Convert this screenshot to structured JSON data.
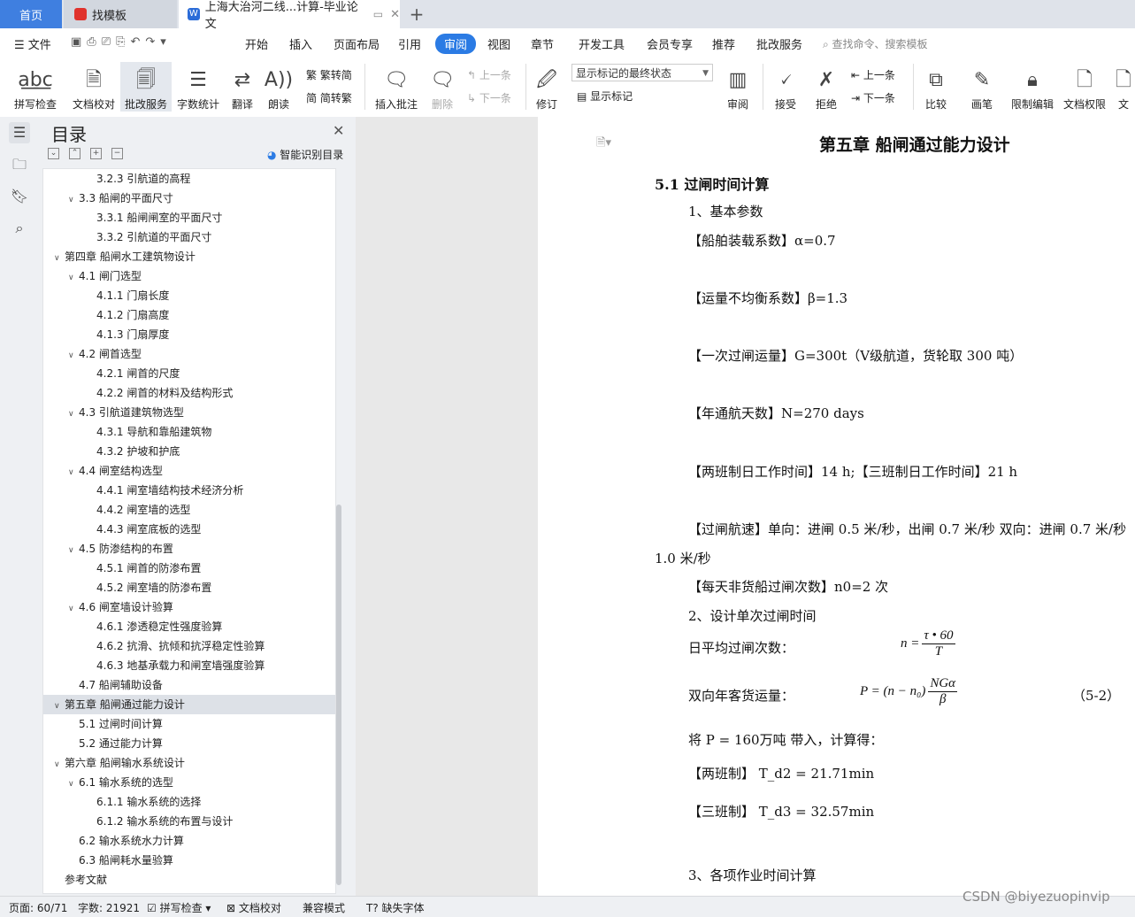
{
  "tabs": {
    "home": "首页",
    "find": "找模板",
    "doc": "上海大治河二线...计算-毕业论文",
    "plus": "+"
  },
  "menu": {
    "file": "文件",
    "items": [
      "开始",
      "插入",
      "页面布局",
      "引用",
      "审阅",
      "视图",
      "章节",
      "开发工具",
      "会员专享",
      "推荐",
      "批改服务"
    ],
    "search": "查找命令、搜索模板"
  },
  "ribbon": {
    "spell": "拼写检查",
    "doccheck": "文档校对",
    "correct": "批改服务",
    "wordcount": "字数统计",
    "translate": "翻译",
    "read": "朗读",
    "trad": "繁转简",
    "simp": "简转繁",
    "insert_comment": "插入批注",
    "delete": "删除",
    "prev": "上一条",
    "next": "下一条",
    "revise": "修订",
    "markup_select": "显示标记的最终状态",
    "show_markup": "显示标记",
    "review": "审阅",
    "accept": "接受",
    "reject": "拒绝",
    "prev2": "上一条",
    "next2": "下一条",
    "compare": "比较",
    "pen": "画笔",
    "restrict": "限制编辑",
    "rights": "文档权限",
    "doc_more": "文"
  },
  "toc": {
    "title": "目录",
    "smart": "智能识别目录",
    "items": [
      {
        "level": 3,
        "text": "3.2.3 引航道的高程"
      },
      {
        "level": 2,
        "text": "3.3 船闸的平面尺寸",
        "caret": "∨"
      },
      {
        "level": 3,
        "text": "3.3.1 船闸闸室的平面尺寸"
      },
      {
        "level": 3,
        "text": "3.3.2 引航道的平面尺寸"
      },
      {
        "level": 1,
        "text": "第四章  船闸水工建筑物设计",
        "caret": "∨"
      },
      {
        "level": 2,
        "text": "4.1 闸门选型",
        "caret": "∨"
      },
      {
        "level": 3,
        "text": "4.1.1 门扇长度"
      },
      {
        "level": 3,
        "text": "4.1.2 门扇高度"
      },
      {
        "level": 3,
        "text": "4.1.3 门扇厚度"
      },
      {
        "level": 2,
        "text": "4.2 闸首选型",
        "caret": "∨"
      },
      {
        "level": 3,
        "text": "4.2.1 闸首的尺度"
      },
      {
        "level": 3,
        "text": "4.2.2 闸首的材料及结构形式"
      },
      {
        "level": 2,
        "text": "4.3 引航道建筑物选型",
        "caret": "∨"
      },
      {
        "level": 3,
        "text": "4.3.1 导航和靠船建筑物"
      },
      {
        "level": 3,
        "text": "4.3.2 护坡和护底"
      },
      {
        "level": 2,
        "text": "4.4 闸室结构选型",
        "caret": "∨"
      },
      {
        "level": 3,
        "text": "4.4.1 闸室墙结构技术经济分析"
      },
      {
        "level": 3,
        "text": "4.4.2 闸室墙的选型"
      },
      {
        "level": 3,
        "text": "4.4.3 闸室底板的选型"
      },
      {
        "level": 2,
        "text": "4.5 防渗结构的布置",
        "caret": "∨"
      },
      {
        "level": 3,
        "text": "4.5.1 闸首的防渗布置"
      },
      {
        "level": 3,
        "text": "4.5.2 闸室墙的防渗布置"
      },
      {
        "level": 2,
        "text": "4.6 闸室墙设计验算",
        "caret": "∨"
      },
      {
        "level": 3,
        "text": "4.6.1 渗透稳定性强度验算"
      },
      {
        "level": 3,
        "text": "4.6.2 抗滑、抗倾和抗浮稳定性验算"
      },
      {
        "level": 3,
        "text": "4.6.3 地基承载力和闸室墙强度验算"
      },
      {
        "level": 2,
        "text": "4.7 船闸辅助设备"
      },
      {
        "level": 1,
        "text": "第五章  船闸通过能力设计",
        "caret": "∨",
        "selected": true
      },
      {
        "level": 2,
        "text": "5.1 过闸时间计算"
      },
      {
        "level": 2,
        "text": "5.2 通过能力计算"
      },
      {
        "level": 1,
        "text": "第六章  船闸输水系统设计",
        "caret": "∨"
      },
      {
        "level": 2,
        "text": "6.1 输水系统的选型",
        "caret": "∨"
      },
      {
        "level": 3,
        "text": "6.1.1 输水系统的选择"
      },
      {
        "level": 3,
        "text": "6.1.2 输水系统的布置与设计"
      },
      {
        "level": 2,
        "text": "6.2 输水系统水力计算"
      },
      {
        "level": 2,
        "text": "6.3 船闸耗水量验算"
      },
      {
        "level": 1,
        "text": "参考文献"
      }
    ]
  },
  "doc": {
    "chapter": "第五章  船闸通过能力设计",
    "section": "5.1 过闸时间计算",
    "p1": "1、基本参数",
    "p2": "【船舶装载系数】α=0.7",
    "p3": "【运量不均衡系数】β=1.3",
    "p4": "【一次过闸运量】G=300t（V级航道，货轮取 300 吨）",
    "p5": "【年通航天数】N=270 days",
    "p6": "【两班制日工作时间】14 h;【三班制日工作时间】21 h",
    "p7": "【过闸航速】单向：进闸 0.5  米/秒，出闸 0.7  米/秒  双向：进闸 0.7  米/秒",
    "p7b": "1.0  米/秒",
    "p8": "【每天非货船过闸次数】n0=2  次",
    "p9": "2、设计单次过闸时间",
    "p10_label": "日平均过闸次数：",
    "f1_lhs": "n =",
    "f1_num": "τ • 60",
    "f1_den": "T",
    "f1_tag": "（",
    "p11_label": "双向年客货运量：",
    "f2_lhs": "P = (n − n₀)",
    "f2_num": "NGα",
    "f2_den": "β",
    "f2_tag": "（5-2）",
    "p12": "将 P = 160万吨 带入，计算得：",
    "p13": "【两班制】 T_d2 = 21.71min",
    "p14": "【三班制】 T_d3 = 32.57min",
    "p15": "3、各项作业时间计算"
  },
  "status": {
    "page": "页面: 60/71",
    "words": "字数: 21921",
    "spell": "拼写检查",
    "doccheck": "文档校对",
    "compat": "兼容模式",
    "missing_font": "缺失字体"
  },
  "watermark": "CSDN @biyezuopinvip"
}
